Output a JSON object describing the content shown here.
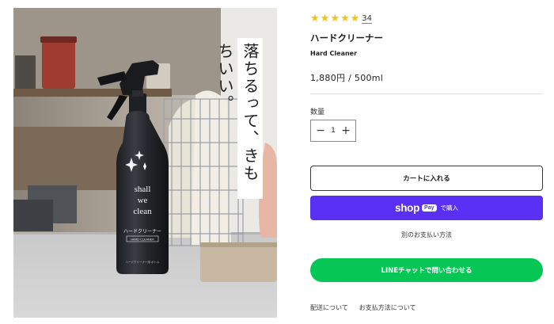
{
  "photo": {
    "catch_copy": "落ちるって、きもちいい。",
    "brand_lines": [
      "shall",
      "we",
      "clean"
    ],
    "label_name": "ハードクリーナー",
    "label_sub": "HARD CLEANER",
    "bottom_text": "ハードクリーナー用 ボトル"
  },
  "product": {
    "rating_count": "34",
    "stars": 5,
    "title": "ハードクリーナー",
    "subtitle": "Hard Cleaner",
    "price": "1,880円 / 500ml"
  },
  "quantity": {
    "label": "数量",
    "minus": "−",
    "value": "1",
    "plus": "+"
  },
  "actions": {
    "cart": "カートに入れる",
    "shop_word": "shop",
    "pay_badge": "Pay",
    "shop_action": "で購入",
    "alt_pay": "別のお支払い方法",
    "line": "LINEチャットで問い合わせる"
  },
  "footer": {
    "shipping": "配送について",
    "payment": "お支払方法について"
  },
  "colors": {
    "star": "#f0c21a",
    "shop_pay": "#5a31f4",
    "line": "#06c755"
  }
}
